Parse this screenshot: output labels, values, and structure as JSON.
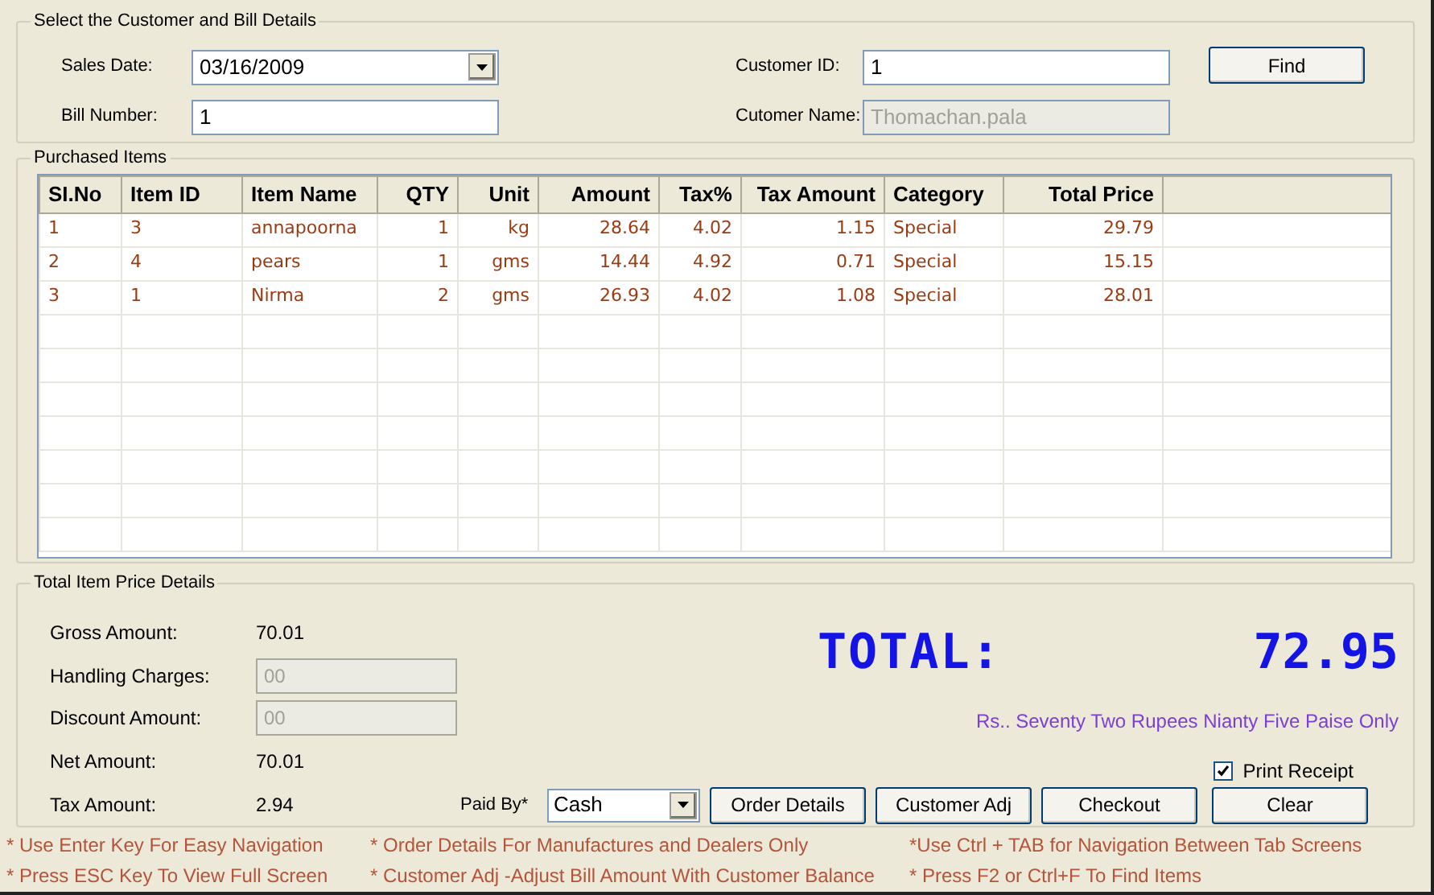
{
  "customer_section": {
    "title": "Select the Customer and Bill Details",
    "fields": [
      {
        "label": "Sales Date:",
        "value": "03/16/2009",
        "kind": "date",
        "disabled": false
      },
      {
        "label": "Customer ID:",
        "value": "1",
        "kind": "text",
        "disabled": false
      },
      {
        "label": "Bill Number:",
        "value": "1",
        "kind": "text",
        "disabled": false
      },
      {
        "label": "Cutomer Name:",
        "value": "Thomachan.pala",
        "kind": "text",
        "disabled": true
      }
    ],
    "find_button": "Find"
  },
  "items_section": {
    "title": "Purchased Items",
    "columns": [
      {
        "label": "SI.No"
      },
      {
        "label": "Item ID"
      },
      {
        "label": "Item Name"
      },
      {
        "label": "QTY"
      },
      {
        "label": "Unit"
      },
      {
        "label": "Amount"
      },
      {
        "label": "Tax%"
      },
      {
        "label": "Tax Amount"
      },
      {
        "label": "Category"
      },
      {
        "label": "Total Price"
      }
    ],
    "rows": [
      [
        "1",
        "3",
        "annapoorna",
        "1",
        "kg",
        "28.64",
        "4.02",
        "1.15",
        "Special",
        "29.79"
      ],
      [
        "2",
        "4",
        "pears",
        "1",
        "gms",
        "14.44",
        "4.92",
        "0.71",
        "Special",
        "15.15"
      ],
      [
        "3",
        "1",
        "Nirma",
        "2",
        "gms",
        "26.93",
        "4.02",
        "1.08",
        "Special",
        "28.01"
      ]
    ]
  },
  "price_section": {
    "title": "Total Item Price Details",
    "lines": [
      {
        "label": "Gross Amount:",
        "value": "70.01",
        "kind": "value"
      },
      {
        "label": "Handling Charges:",
        "value": "00",
        "kind": "field"
      },
      {
        "label": "Discount Amount:",
        "value": "00",
        "kind": "field"
      },
      {
        "label": "Net Amount:",
        "value": "70.01",
        "kind": "value"
      },
      {
        "label": "Tax Amount:",
        "value": "2.94",
        "kind": "value"
      }
    ],
    "total_label": "TOTAL:",
    "total_value": "72.95",
    "amount_in_words": "Rs.. Seventy Two Rupees Nianty Five Paise Only",
    "print_receipt": {
      "label": "Print Receipt",
      "checked": true
    },
    "paid_by": {
      "label": "Paid By*",
      "value": "Cash"
    },
    "buttons": [
      "Order Details",
      "Customer Adj",
      "Checkout",
      "Clear"
    ]
  },
  "hints": [
    "* Use Enter Key For Easy Navigation",
    "* Order Details For Manufactures and Dealers Only",
    "*Use Ctrl + TAB for Navigation Between Tab Screens",
    "* Press ESC Key To View Full Screen",
    "* Customer Adj -Adjust Bill Amount With Customer Balance",
    "* Press F2 or Ctrl+F To Find Items"
  ]
}
